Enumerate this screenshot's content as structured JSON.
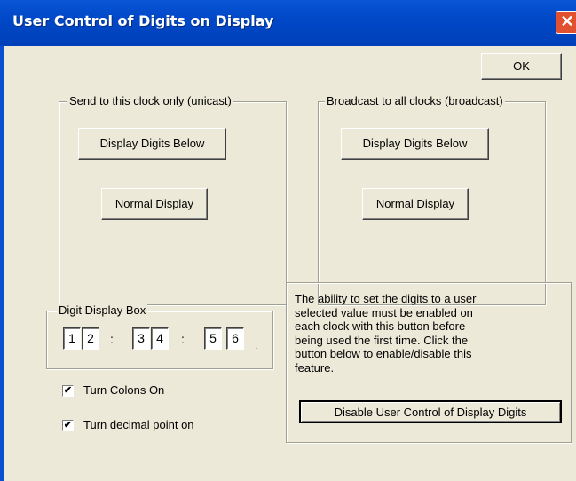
{
  "window": {
    "title": "User Control of Digits on Display",
    "close_icon": "close-icon"
  },
  "ok_button": "OK",
  "unicast": {
    "legend": "Send to this clock only (unicast)",
    "display_digits_label": "Display Digits Below",
    "normal_display_label": "Normal Display"
  },
  "broadcast": {
    "legend": "Broadcast to all clocks (broadcast)",
    "display_digits_label": "Display Digits Below",
    "normal_display_label": "Normal Display"
  },
  "digit_box": {
    "legend": "Digit Display Box",
    "digits": [
      "1",
      "2",
      "3",
      "4",
      "5",
      "6"
    ],
    "separator": ":",
    "decimal_point": "."
  },
  "checkboxes": [
    {
      "label": "Turn Colons On",
      "checked": true
    },
    {
      "label": "Turn decimal point on",
      "checked": true
    }
  ],
  "info": {
    "text": "The ability to set the digits to a user selected value must be enabled on each clock with this button before being used the first time. Click the button below to enable/disable this feature.",
    "button_label": "Disable User Control of Display Digits"
  }
}
